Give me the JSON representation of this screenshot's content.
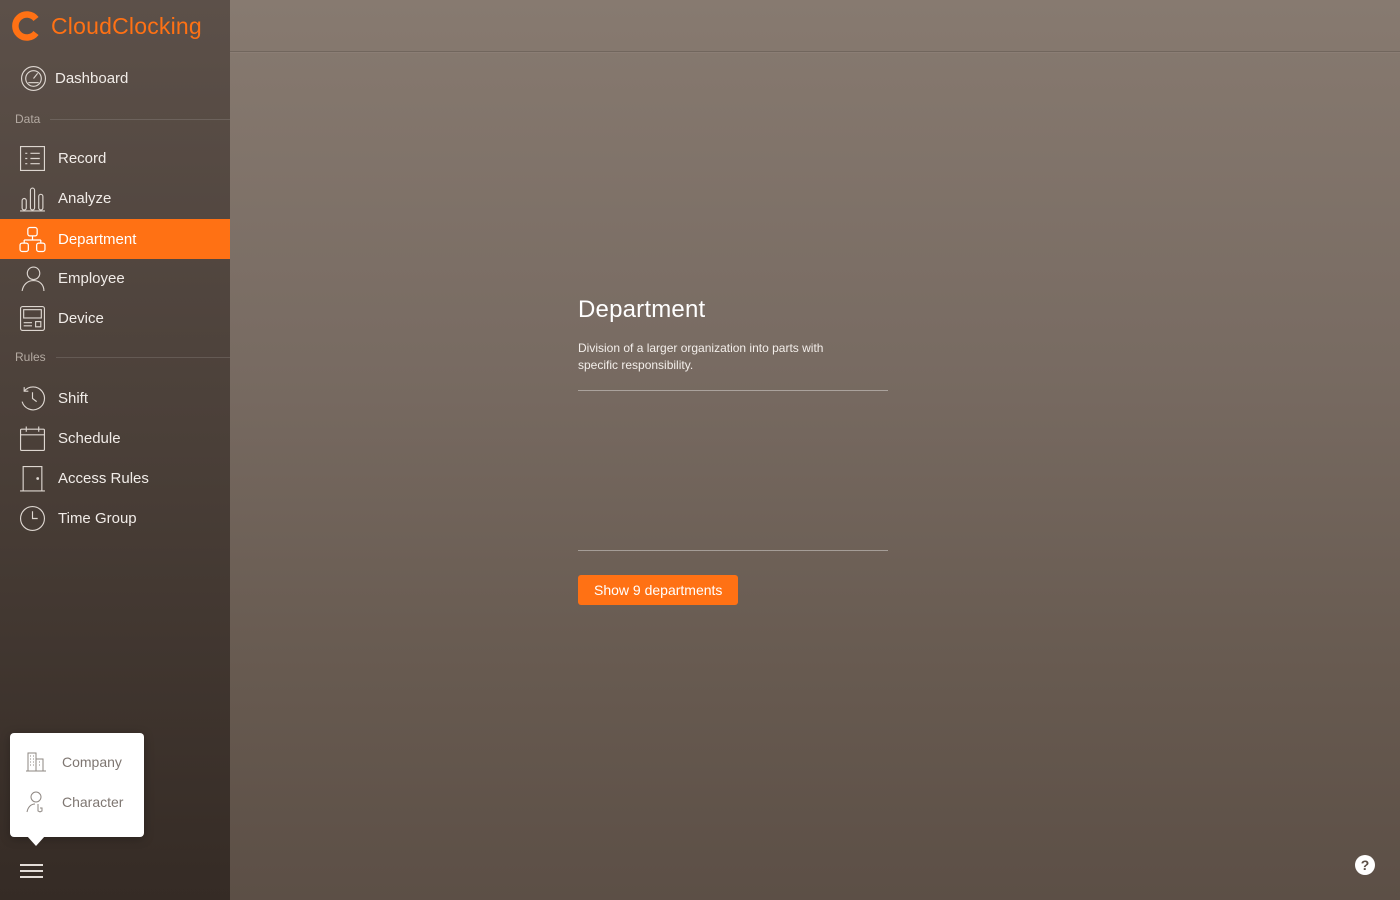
{
  "app": {
    "name": "CloudClocking",
    "accent_color": "#ff7114"
  },
  "sidebar": {
    "dashboard": {
      "label": "Dashboard",
      "icon": "dashboard-gauge-icon"
    },
    "sections": {
      "data": "Data",
      "rules": "Rules"
    },
    "data_items": [
      {
        "label": "Record",
        "icon": "list-icon"
      },
      {
        "label": "Analyze",
        "icon": "bar-chart-icon"
      },
      {
        "label": "Department",
        "icon": "org-chart-icon",
        "active": true
      },
      {
        "label": "Employee",
        "icon": "person-icon"
      },
      {
        "label": "Device",
        "icon": "device-icon"
      }
    ],
    "rule_items": [
      {
        "label": "Shift",
        "icon": "shift-clock-icon"
      },
      {
        "label": "Schedule",
        "icon": "calendar-icon"
      },
      {
        "label": "Access Rules",
        "icon": "door-icon"
      },
      {
        "label": "Time Group",
        "icon": "clock-icon"
      }
    ],
    "popup_menu": [
      {
        "label": "Company",
        "icon": "building-icon"
      },
      {
        "label": "Character",
        "icon": "user-key-icon"
      }
    ],
    "menu_icon": "hamburger-icon"
  },
  "main": {
    "title": "Department",
    "description": "Division of a larger organization into parts with specific responsibility.",
    "button_label": "Show 9 departments",
    "help_label": "?"
  }
}
